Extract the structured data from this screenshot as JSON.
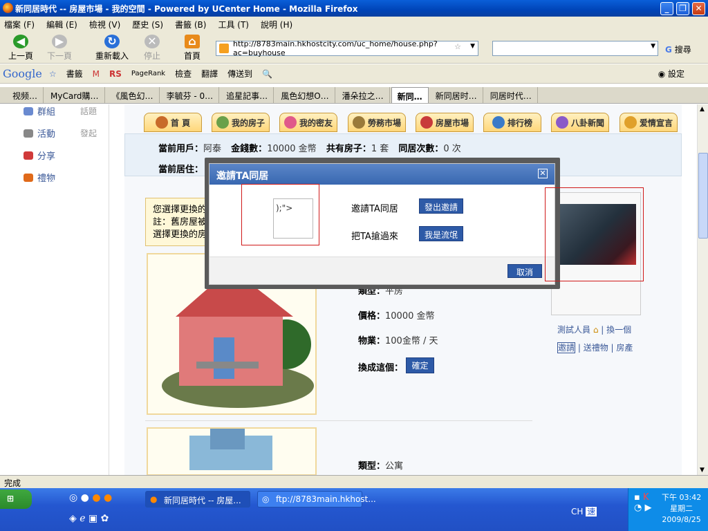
{
  "window": {
    "title": "新同居時代 -- 房屋市場 - 我的空間 - Powered by UCenter Home - Mozilla Firefox"
  },
  "menu": [
    "檔案 (F)",
    "編輯 (E)",
    "檢視 (V)",
    "歷史 (S)",
    "書籤 (B)",
    "工具 (T)",
    "說明 (H)"
  ],
  "nav": {
    "back": "上一頁",
    "forward": "下一頁",
    "reload": "重新載入",
    "stop": "停止",
    "home": "首頁",
    "url": "http://8783main.hkhostcity.com/uc_home/house.php?ac=buyhouse",
    "search_engine": "搜尋"
  },
  "googlebar": {
    "logo": "Google",
    "bookmarks": "書籤",
    "pagerank": "PageRank",
    "check": "檢查",
    "translate": "翻譯",
    "sendto": "傳送到",
    "settings": "設定"
  },
  "tabs": [
    "视频…",
    "MyCard購…",
    "《風色幻…",
    "李毓芬 - 0…",
    "追星記事…",
    "風色幻想O…",
    "潘朵拉之…",
    "新同…",
    "新同居时…",
    "同居时代…"
  ],
  "sidebar": {
    "items": [
      {
        "label": "群組",
        "sub": "話題"
      },
      {
        "label": "活動",
        "sub": "發起"
      },
      {
        "label": "分享",
        "sub": ""
      },
      {
        "label": "禮物",
        "sub": ""
      }
    ]
  },
  "topnav": [
    "首 頁",
    "我的房子",
    "我的密友",
    "勞務市場",
    "房屋市場",
    "排行榜",
    "八卦新聞",
    "爱情宣言"
  ],
  "info": {
    "user_label": "當前用戶：",
    "user": "阿泰",
    "money_label": "金錢數：",
    "money": "10000 金幣",
    "houses_label": "共有房子：",
    "houses": "1 套",
    "cohabit_label": "同居次數：",
    "cohabit": "0 次",
    "residence_label": "當前居住："
  },
  "notice": {
    "line1": "您選擇更換的",
    "line2": "註：舊房屋被",
    "line3": "選擇更換的房"
  },
  "house1": {
    "type_label": "類型：",
    "type": "平房",
    "price_label": "價格：",
    "price": "10000 金幣",
    "fee_label": "物業：",
    "fee": "100金幣 / 天",
    "change_label": "換成這個：",
    "confirm": "確定"
  },
  "house2": {
    "type_label": "類型：",
    "type": "公寓"
  },
  "card": {
    "name": "測試人員",
    "switch": "換一個",
    "invite": "邀請",
    "gift": "送禮物",
    "house": "房產"
  },
  "dialog": {
    "title": "邀請TA同居",
    "avatar_text": ");\">",
    "invite_label": "邀請TA同居",
    "invite_button": "發出邀請",
    "grab_label": "把TA搶過來",
    "grab_button": "我是流氓",
    "cancel": "取消"
  },
  "status": "完成",
  "taskbar": {
    "tasks": [
      "新同居時代 -- 房屋...",
      "ftp://8783main.hkhost..."
    ],
    "lang": "CH",
    "time": "下午 03:42",
    "weekday": "星期二",
    "date": "2009/8/25"
  }
}
